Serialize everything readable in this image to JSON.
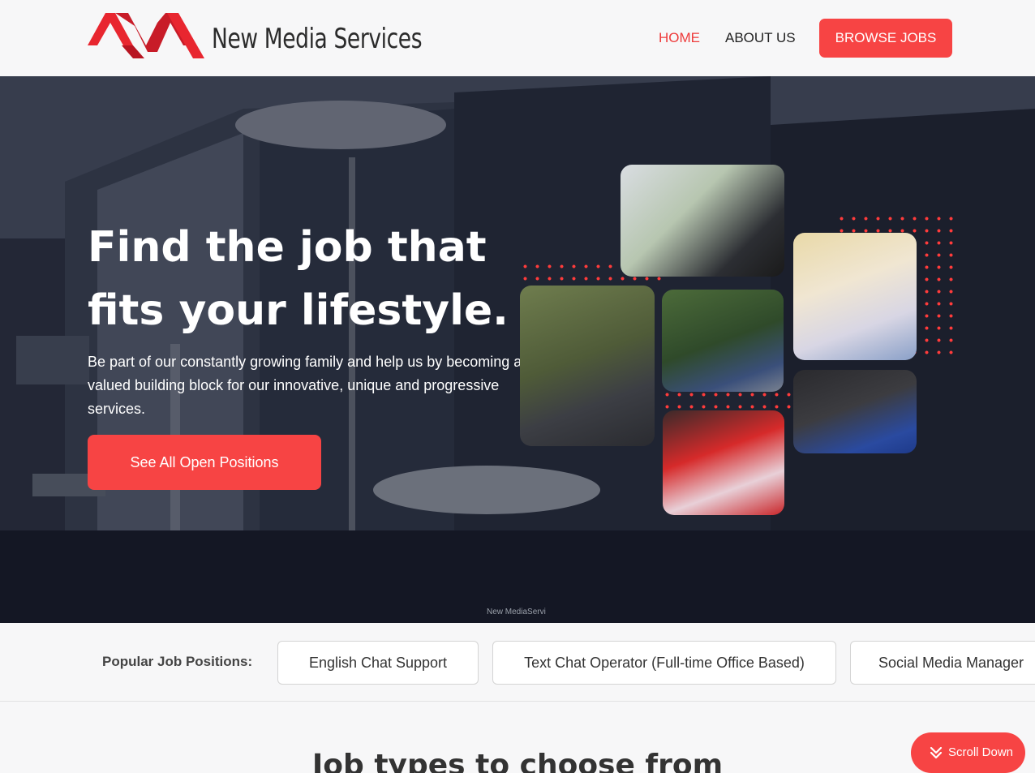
{
  "header": {
    "brand_name": "New Media Services",
    "nav": {
      "home": "HOME",
      "about": "ABOUT US",
      "browse": "BROWSE JOBS"
    }
  },
  "hero": {
    "title_line1": "Find the job that",
    "title_line2": "fits your lifestyle.",
    "subtitle": "Be part of our constantly growing family and help us by becoming a valued building block for our innovative, unique and progressive services.",
    "cta": "See All Open Positions",
    "sign_text": "New MediaServi"
  },
  "popular": {
    "label": "Popular Job Positions:",
    "positions": [
      "English Chat Support",
      "Text Chat Operator (Full-time Office Based)",
      "Social Media Manager"
    ]
  },
  "section": {
    "title": "Job types to choose from"
  },
  "scroll": {
    "label": "Scroll Down",
    "icon": "double-chevron-down-icon"
  },
  "colors": {
    "accent": "#f74444",
    "nav_active": "#ee3b3b",
    "text_dark": "#2b2b2b"
  }
}
